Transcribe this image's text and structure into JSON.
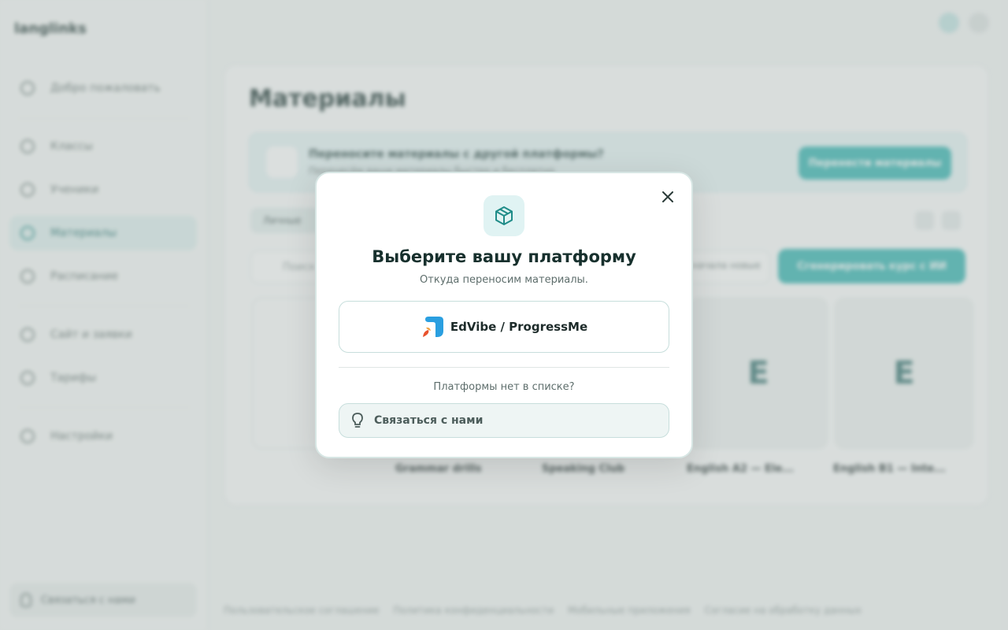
{
  "app": {
    "logo": "langlinks",
    "sidebar": {
      "items": [
        {
          "label": "Добро пожаловать",
          "icon": "home-icon"
        },
        {
          "label": "Классы",
          "icon": "classes-icon"
        },
        {
          "label": "Ученики",
          "icon": "students-icon"
        },
        {
          "label": "Материалы",
          "icon": "materials-icon",
          "active": true
        },
        {
          "label": "Расписание",
          "icon": "calendar-icon"
        },
        {
          "label": "Сайт и заявки",
          "icon": "site-icon"
        },
        {
          "label": "Тарифы",
          "icon": "pricing-icon"
        },
        {
          "label": "Настройки",
          "icon": "settings-icon"
        }
      ],
      "contact_label": "Связаться с нами"
    },
    "main": {
      "title": "Материалы",
      "banner_title": "Переносите материалы с другой платформы?",
      "banner_sub": "Перенесём ваши материалы быстро и бесплатно",
      "banner_button": "Перенести материалы",
      "tab_label": "Личные",
      "search_placeholder": "Поиск",
      "sort_label": "Сначала новые",
      "create_button": "Сгенерировать курс с ИИ",
      "cards": [
        {
          "letter": "",
          "name": ""
        },
        {
          "letter": "",
          "name": "Grammar drills"
        },
        {
          "letter": "",
          "name": "Speaking Club"
        },
        {
          "letter": "E",
          "name": "English A2 — Ele..."
        },
        {
          "letter": "E",
          "name": "English B1 — Inte..."
        }
      ],
      "footer_links": [
        "Пользовательское соглашение",
        "Политика конфиденциальности",
        "Мобильные приложения",
        "Согласие на обработку данных"
      ]
    }
  },
  "modal": {
    "title": "Выберите вашу платформу",
    "subtitle": "Откуда переносим материалы.",
    "platform_label": "EdVibe / ProgressMe",
    "not_listed": "Платформы нет в списке?",
    "contact_label": "Связаться с нами",
    "icons": {
      "header": "box-icon",
      "close": "close-icon",
      "platform": "edvibe-logo-icon",
      "contact": "lightbulb-icon"
    },
    "colors": {
      "accent": "#1f8c88",
      "icon_bg": "#e0f3f3",
      "border": "#c7dedc"
    }
  }
}
